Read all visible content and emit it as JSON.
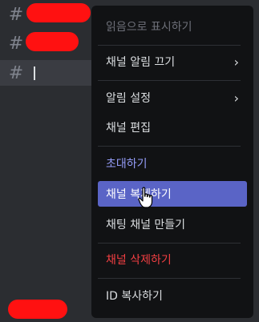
{
  "sidebar": {
    "channels": [
      {
        "hash": "#"
      },
      {
        "hash": "#"
      },
      {
        "hash": "#"
      }
    ]
  },
  "menu": {
    "mark_as_read": "읽음으로 표시하기",
    "mute_channel": "채널 알림 끄기",
    "notification_settings": "알림 설정",
    "edit_channel": "채널 편집",
    "invite": "초대하기",
    "duplicate_channel": "채널 복제하기",
    "create_text_channel": "채팅 채널 만들기",
    "delete_channel": "채널 삭제하기",
    "copy_id": "ID 복사하기",
    "submenu_chevron": "›"
  },
  "colors": {
    "menu_bg": "#111214",
    "hover_bg": "#5a64c6",
    "invite_text": "#949cf7",
    "danger_text": "#f23f42",
    "redaction": "#ff1111"
  }
}
